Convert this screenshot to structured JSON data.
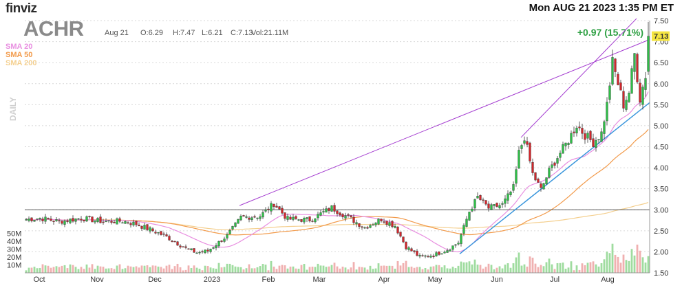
{
  "header": {
    "logo": "finviz",
    "datetime": "Mon AUG 21 2023 1:35 PM ET",
    "ticker": "ACHR",
    "date": "Aug 21",
    "open": "O:6.29",
    "high": "H:7.47",
    "low": "L:6.21",
    "close": "C:7.13",
    "volume": "Vol:21.11M",
    "change": "+0.97 (15.71%)",
    "timeframe": "DAILY",
    "last_price": "7.13"
  },
  "legend": [
    {
      "label": "SMA 20",
      "color": "#e88ee0"
    },
    {
      "label": "SMA 50",
      "color": "#f29a4a"
    },
    {
      "label": "SMA 200",
      "color": "#f4cf8e"
    }
  ],
  "colors": {
    "up": "#2fbf48",
    "down": "#d2262b",
    "trend": "#a43cd0",
    "support": "#3a96dc",
    "hline": "#555555"
  },
  "chart_data": {
    "type": "candlestick",
    "y_axis": {
      "min": 1.5,
      "max": 7.5,
      "ticks": [
        "1.50",
        "2.00",
        "2.50",
        "3.00",
        "3.50",
        "4.00",
        "4.50",
        "5.00",
        "5.50",
        "6.00",
        "6.50",
        "7.00",
        "7.50"
      ]
    },
    "x_axis": {
      "ticks": [
        "Oct",
        "Nov",
        "Dec",
        "2023",
        "Feb",
        "Mar",
        "Apr",
        "May",
        "Jun",
        "Jul",
        "Aug"
      ]
    },
    "volume_axis": {
      "ticks": [
        "10M",
        "20M",
        "30M",
        "40M",
        "50M"
      ]
    },
    "horizontal_line": 3.0,
    "anchors": [
      {
        "i": 0,
        "c": 2.77
      },
      {
        "i": 5,
        "c": 2.8
      },
      {
        "i": 12,
        "c": 2.72
      },
      {
        "i": 20,
        "c": 2.8
      },
      {
        "i": 28,
        "c": 2.72
      },
      {
        "i": 35,
        "c": 2.73
      },
      {
        "i": 40,
        "c": 2.66
      },
      {
        "i": 48,
        "c": 2.45
      },
      {
        "i": 52,
        "c": 2.32
      },
      {
        "i": 58,
        "c": 2.08
      },
      {
        "i": 62,
        "c": 1.98
      },
      {
        "i": 66,
        "c": 2.02
      },
      {
        "i": 73,
        "c": 2.38
      },
      {
        "i": 78,
        "c": 2.82
      },
      {
        "i": 85,
        "c": 2.85
      },
      {
        "i": 90,
        "c": 3.15
      },
      {
        "i": 95,
        "c": 2.78
      },
      {
        "i": 103,
        "c": 2.76
      },
      {
        "i": 111,
        "c": 3.05
      },
      {
        "i": 117,
        "c": 2.82
      },
      {
        "i": 123,
        "c": 2.58
      },
      {
        "i": 129,
        "c": 2.78
      },
      {
        "i": 134,
        "c": 2.62
      },
      {
        "i": 138,
        "c": 2.12
      },
      {
        "i": 143,
        "c": 1.88
      },
      {
        "i": 148,
        "c": 1.92
      },
      {
        "i": 153,
        "c": 2.05
      },
      {
        "i": 157,
        "c": 2.22
      },
      {
        "i": 161,
        "c": 2.96
      },
      {
        "i": 164,
        "c": 3.3
      },
      {
        "i": 168,
        "c": 3.04
      },
      {
        "i": 173,
        "c": 3.12
      },
      {
        "i": 177,
        "c": 3.52
      },
      {
        "i": 179,
        "c": 4.35
      },
      {
        "i": 181,
        "c": 4.74
      },
      {
        "i": 184,
        "c": 3.85
      },
      {
        "i": 187,
        "c": 3.48
      },
      {
        "i": 190,
        "c": 3.92
      },
      {
        "i": 193,
        "c": 4.25
      },
      {
        "i": 197,
        "c": 4.66
      },
      {
        "i": 200,
        "c": 5.02
      },
      {
        "i": 203,
        "c": 4.78
      },
      {
        "i": 206,
        "c": 4.6
      },
      {
        "i": 209,
        "c": 4.82
      },
      {
        "i": 211,
        "c": 5.5
      },
      {
        "i": 213,
        "c": 6.5
      },
      {
        "i": 215,
        "c": 6.0
      },
      {
        "i": 217,
        "c": 5.5
      },
      {
        "i": 219,
        "c": 5.8
      },
      {
        "i": 221,
        "c": 6.7
      },
      {
        "i": 223,
        "c": 5.65
      },
      {
        "i": 225,
        "c": 6.2
      },
      {
        "i": 226,
        "c": 7.13
      }
    ],
    "last_candle": {
      "open": 6.29,
      "high": 7.47,
      "low": 6.21,
      "close": 7.13,
      "volume_m": 21.11
    }
  }
}
